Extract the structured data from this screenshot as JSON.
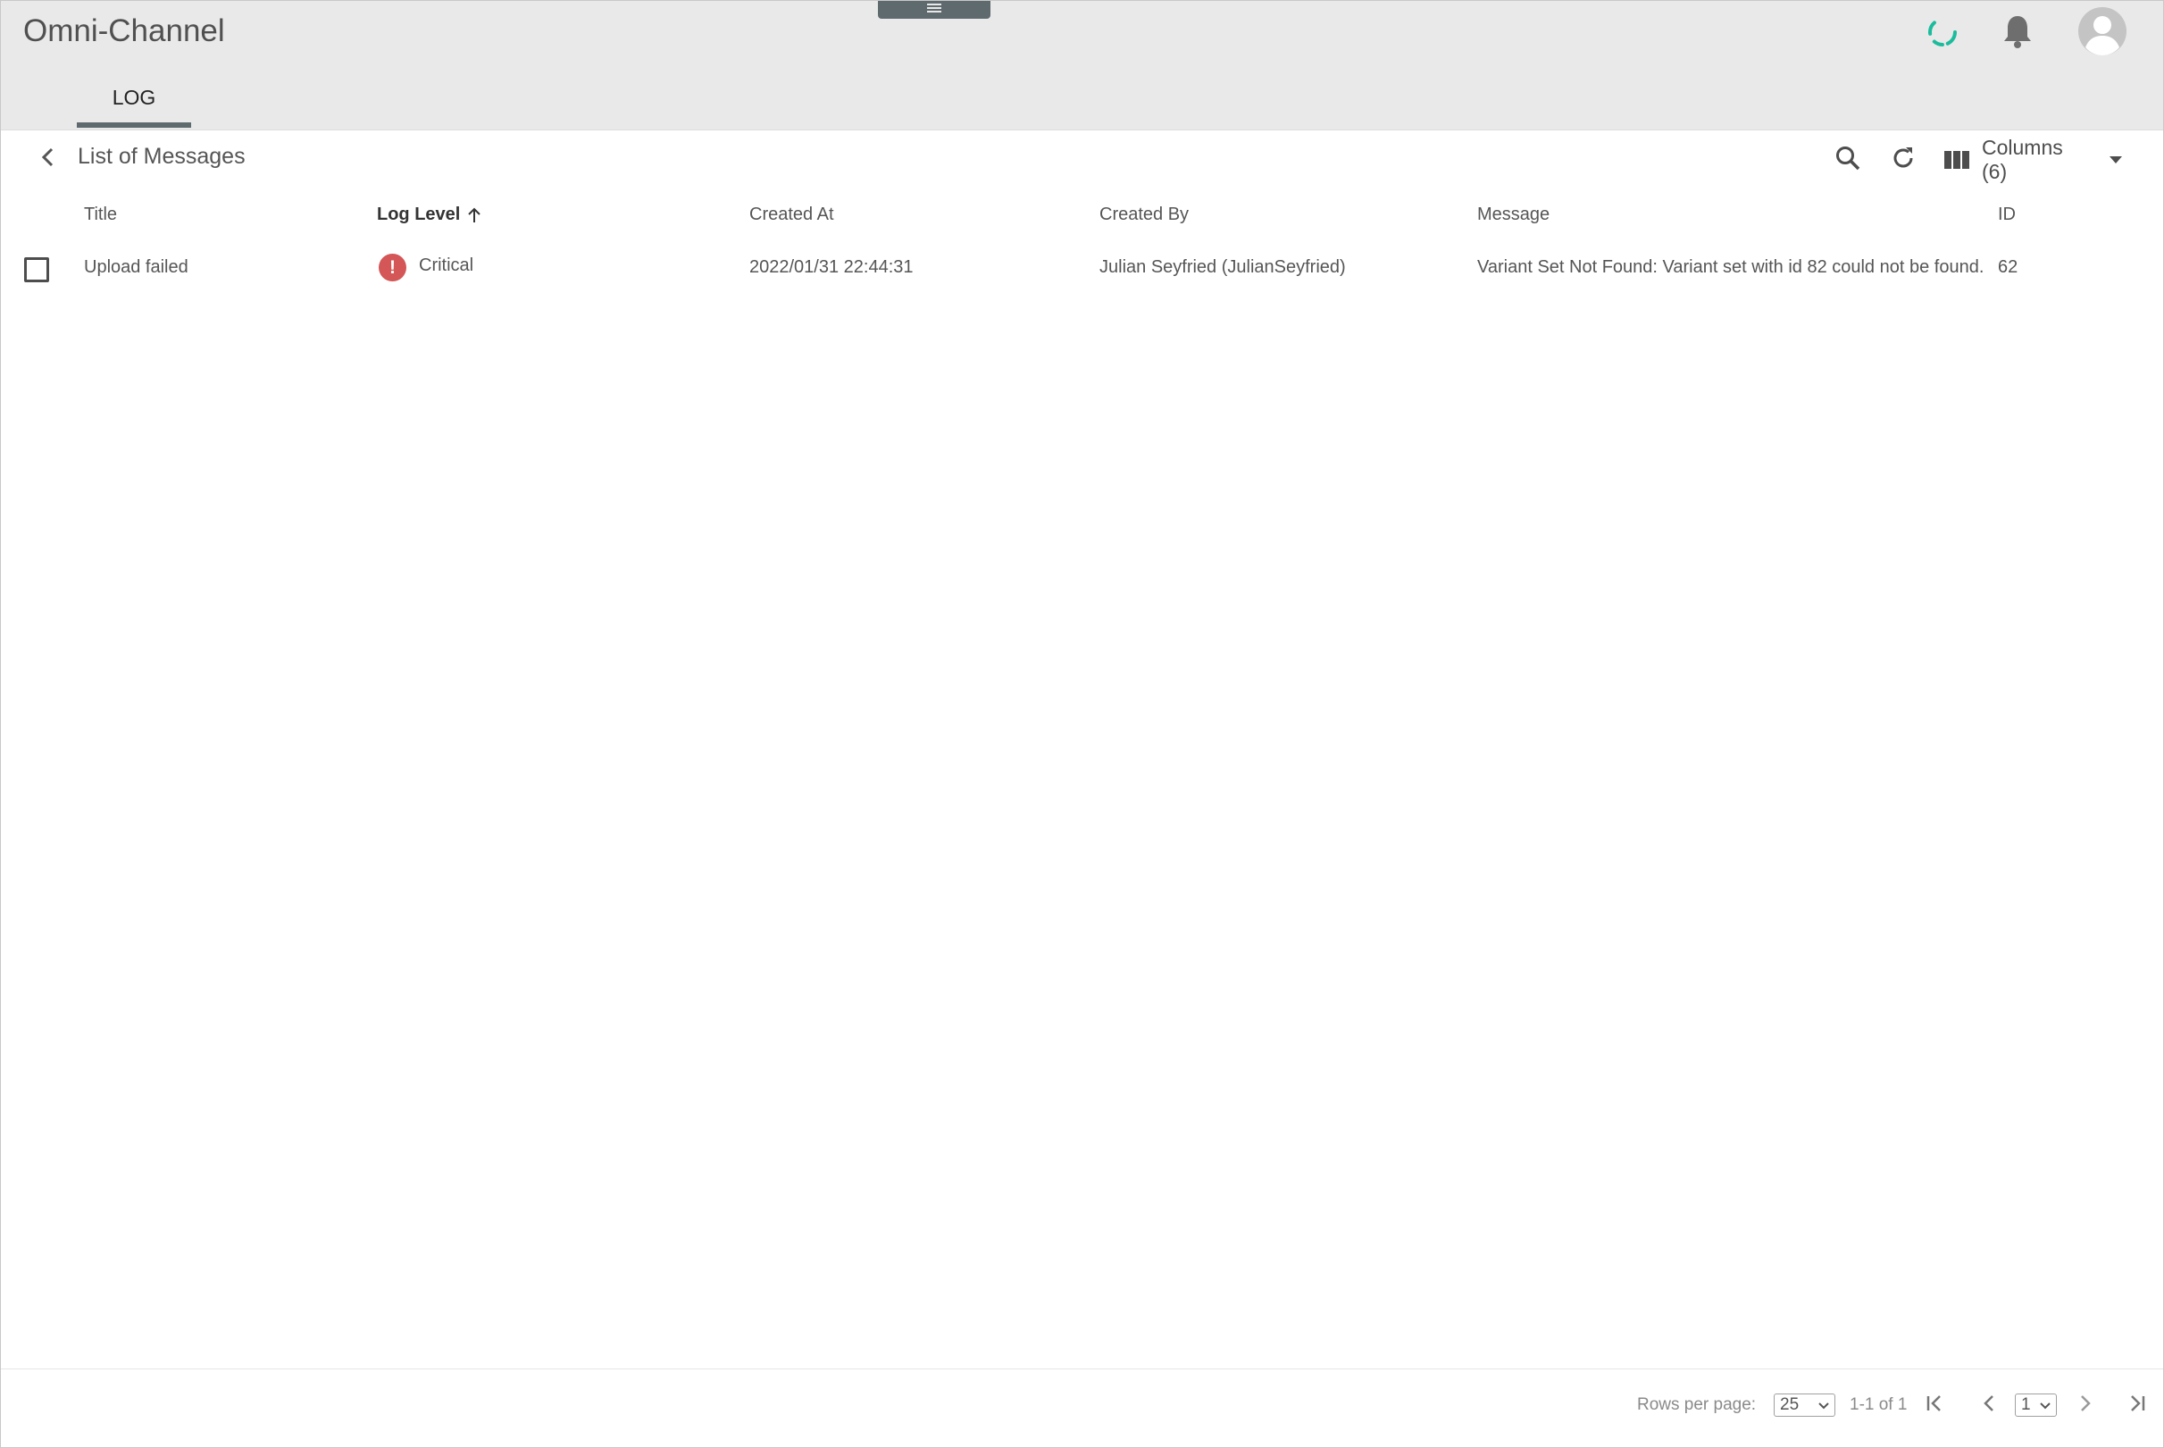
{
  "header": {
    "app_title": "Omni-Channel",
    "tabs": [
      {
        "label": "LOG",
        "active": true
      }
    ],
    "icons": {
      "menu": "menu-icon",
      "sync": "sync-spinner-icon",
      "notifications": "bell-icon",
      "account": "avatar-icon"
    },
    "accent_color": "#1abc9c"
  },
  "toolbar": {
    "title": "List of Messages",
    "columns_label": "Columns (6)"
  },
  "table": {
    "columns": [
      "Title",
      "Log Level",
      "Created At",
      "Created By",
      "Message",
      "ID"
    ],
    "sorted_column": "Log Level",
    "sort_direction": "ascending",
    "rows": [
      {
        "title": "Upload failed",
        "log_level": "Critical",
        "log_level_color": "#d45656",
        "created_at": "2022/01/31 22:44:31",
        "created_by": "Julian Seyfried (JulianSeyfried)",
        "message": "Variant Set Not Found: Variant set with id 82 could not be found.",
        "id": "62"
      }
    ]
  },
  "pagination": {
    "rows_per_page_label": "Rows per page:",
    "rows_per_page": "25",
    "range": "1-1 of 1",
    "page": "1"
  }
}
